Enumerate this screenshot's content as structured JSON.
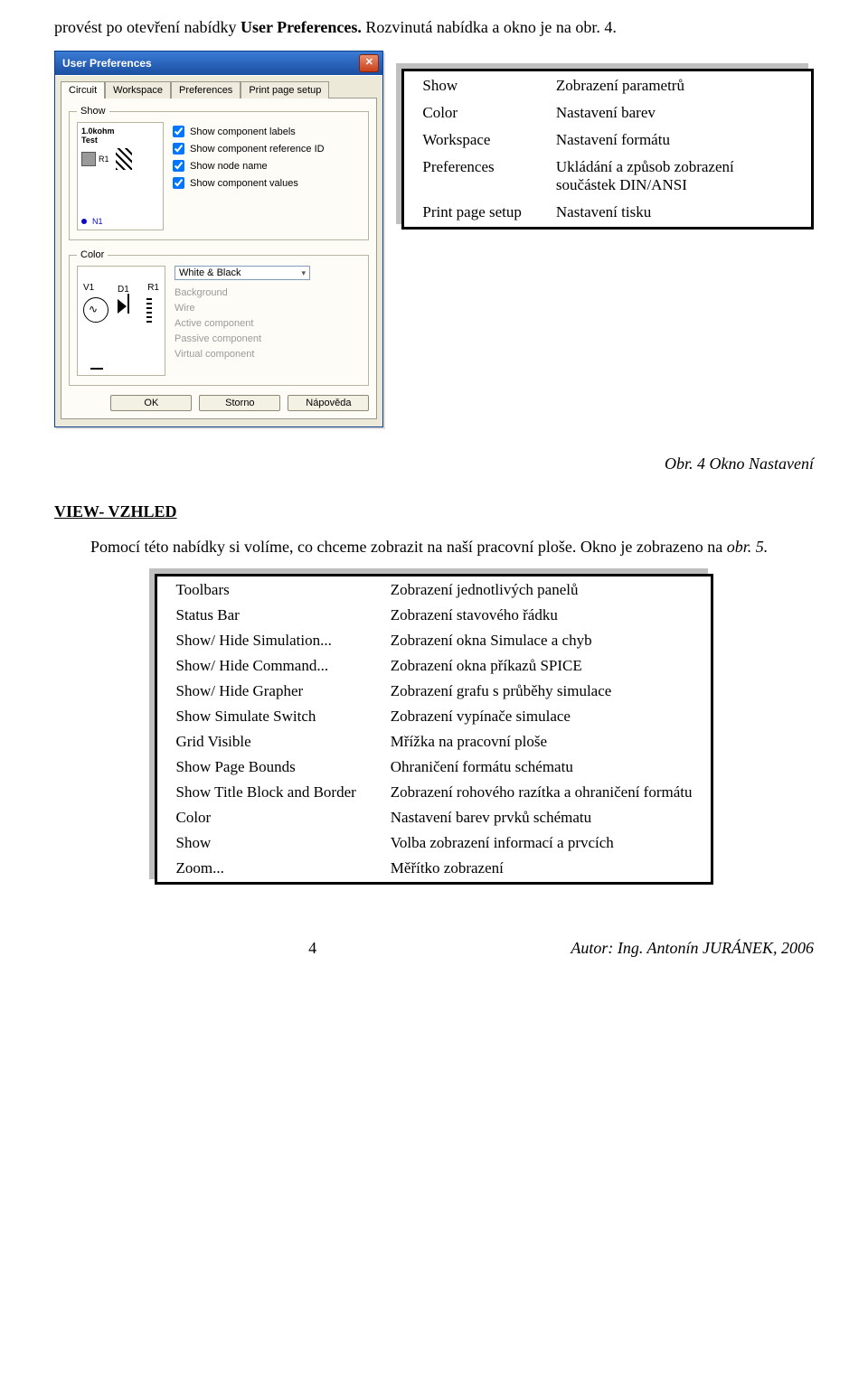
{
  "intro_lead": "provést po otevření nabídky ",
  "intro_bold": "User Preferences.",
  "intro_tail": " Rozvinutá nabídka a okno je na obr. 4.",
  "dialog": {
    "title": "User Preferences",
    "tabs": [
      "Circuit",
      "Workspace",
      "Preferences",
      "Print page setup"
    ],
    "legend_show": "Show",
    "preview_label1": "1.0kohm",
    "preview_label2": "Test",
    "preview_r1": "R1",
    "preview_n1": "N1",
    "checks": [
      "Show component labels",
      "Show component reference ID",
      "Show node name",
      "Show component values"
    ],
    "legend_color": "Color",
    "schem_v1": "V1",
    "schem_d1": "D1",
    "schem_r1": "R1",
    "color_value": "White & Black",
    "gray_items": [
      "Background",
      "Wire",
      "Active component",
      "Passive component",
      "Virtual component"
    ],
    "btn_ok": "OK",
    "btn_cancel": "Storno",
    "btn_help": "Nápověda"
  },
  "side_table": {
    "rows": [
      [
        "Show",
        "Zobrazení parametrů"
      ],
      [
        "Color",
        "Nastavení barev"
      ],
      [
        "Workspace",
        "Nastavení formátu"
      ],
      [
        "Preferences",
        "Ukládání a způsob zobrazení součástek DIN/ANSI"
      ],
      [
        "Print page setup",
        "Nastavení tisku"
      ]
    ]
  },
  "caption": "Obr. 4 Okno Nastavení",
  "view_heading": "VIEW- VZHLED",
  "view_body_lead": "Pomocí této nabídky si volíme, co chceme zobrazit na naší pracovní ploše. Okno je zobrazeno na ",
  "view_body_italic": "obr. 5.",
  "big_table": {
    "rows": [
      [
        "Toolbars",
        "Zobrazení jednotlivých panelů"
      ],
      [
        "Status Bar",
        "Zobrazení stavového řádku"
      ],
      [
        "Show/ Hide Simulation...",
        "Zobrazení okna Simulace a chyb"
      ],
      [
        "Show/ Hide Command...",
        "Zobrazení okna příkazů SPICE"
      ],
      [
        "Show/ Hide Grapher",
        "Zobrazení grafu s průběhy simulace"
      ],
      [
        "Show Simulate Switch",
        "Zobrazení vypínače simulace"
      ],
      [
        "Grid Visible",
        "Mřížka na pracovní ploše"
      ],
      [
        "Show Page Bounds",
        "Ohraničení formátu schématu"
      ],
      [
        "Show Title Block and Border",
        "Zobrazení rohového razítka a ohraničení formátu"
      ],
      [
        "Color",
        "Nastavení barev prvků schématu"
      ],
      [
        "Show",
        "Volba zobrazení informací a prvcích"
      ],
      [
        "Zoom...",
        "Měřítko zobrazení"
      ]
    ]
  },
  "page_number": "4",
  "author_label": "Autor: Ing. Antonín JURÁNEK, 2006"
}
